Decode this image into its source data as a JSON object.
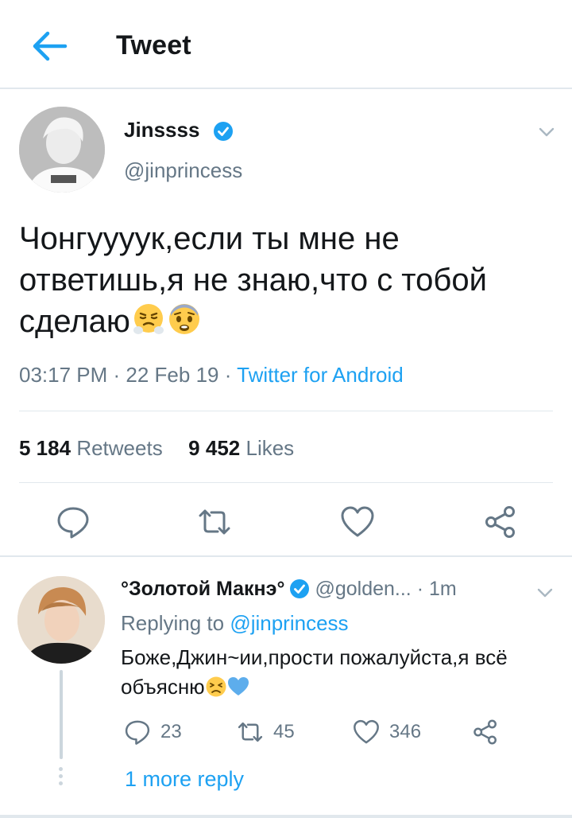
{
  "header": {
    "title": "Tweet",
    "back_icon": "arrow-left-icon",
    "accent": "#1da1f2"
  },
  "tweet": {
    "author_name": "Jinssss",
    "handle": "@jinprincess",
    "verified": true,
    "text": "Чонгуууук,если ты мне не ответишь,я не знаю,что с тобой сделаю",
    "emojis": [
      "steam-from-nose-face",
      "fearful-face"
    ],
    "time": "03:17 PM",
    "date": "22 Feb 19",
    "source": "Twitter for Android",
    "retweets_count": "5 184",
    "retweets_label": "Retweets",
    "likes_count": "9 452",
    "likes_label": "Likes",
    "actions": [
      "reply-icon",
      "retweet-icon",
      "heart-icon",
      "share-icon"
    ]
  },
  "reply": {
    "author_name": "°Золотой Макнэ°",
    "verified": true,
    "handle": "@golden...",
    "time": "· 1m",
    "replying_prefix": "Replying to",
    "replying_mention": "@jinprincess",
    "text": "Боже,Джин~ии,прости пожалуйста,я всё объясню",
    "emojis": [
      "persevering-face",
      "blue-heart"
    ],
    "reply_count": "23",
    "retweet_count": "45",
    "like_count": "346"
  },
  "more_replies": "1 more reply",
  "colors": {
    "text": "#14171a",
    "secondary": "#657786",
    "link": "#1da1f2",
    "divider": "#e1e8ed"
  }
}
